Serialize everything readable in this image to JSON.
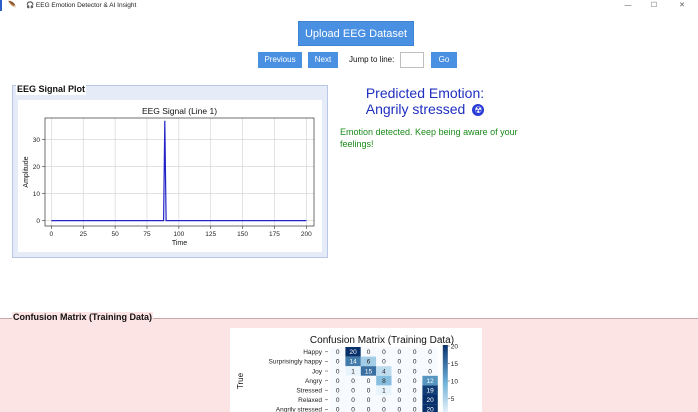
{
  "window": {
    "title": "🎧 EEG Emotion Detector & AI Insight",
    "icon": "headphones-icon",
    "controls": [
      "—",
      "☐",
      "✕"
    ]
  },
  "toolbar": {
    "upload_label": "Upload EEG Dataset",
    "previous_label": "Previous",
    "next_label": "Next",
    "jump_label": "Jump to line:",
    "jump_value": "",
    "go_label": "Go"
  },
  "plot_panel": {
    "legend": "EEG Signal Plot"
  },
  "prediction": {
    "title": "Predicted Emotion:",
    "value": "Angrily stressed",
    "icon": "radioactive-icon",
    "icon_glyph": "☢",
    "message": "Emotion detected. Keep being aware of your feelings!"
  },
  "confusion_panel": {
    "legend": "Confusion Matrix (Training Data)"
  },
  "chart_data": [
    {
      "type": "line",
      "title": "EEG Signal (Line 1)",
      "xlabel": "Time",
      "ylabel": "Amplitude",
      "xlim": [
        -5,
        206
      ],
      "ylim": [
        -2,
        38
      ],
      "xticks": [
        0,
        25,
        50,
        75,
        100,
        125,
        150,
        175,
        200
      ],
      "yticks": [
        0,
        10,
        20,
        30
      ],
      "grid": true,
      "color": "#2323c8",
      "series": [
        {
          "x": [
            0,
            86,
            88,
            89,
            90,
            92,
            200
          ],
          "y": [
            0,
            0,
            0,
            37,
            0,
            0,
            0
          ]
        }
      ]
    },
    {
      "type": "heatmap",
      "title": "Confusion Matrix (Training Data)",
      "ylabel": "True",
      "rows": [
        "Happy",
        "Surprisingly happy",
        "Joy",
        "Angry",
        "Stressed",
        "Relaxed",
        "Angrily stressed"
      ],
      "values": [
        [
          0,
          20,
          0,
          0,
          0,
          0,
          0
        ],
        [
          0,
          14,
          6,
          0,
          0,
          0,
          0
        ],
        [
          0,
          1,
          15,
          4,
          0,
          0,
          0
        ],
        [
          0,
          0,
          0,
          8,
          0,
          0,
          12
        ],
        [
          0,
          0,
          0,
          1,
          0,
          0,
          19
        ],
        [
          0,
          0,
          0,
          0,
          0,
          0,
          20
        ],
        [
          0,
          0,
          0,
          0,
          0,
          0,
          20
        ]
      ],
      "colorbar_ticks": [
        5,
        10,
        15,
        20
      ],
      "colormap": "Blues"
    }
  ]
}
